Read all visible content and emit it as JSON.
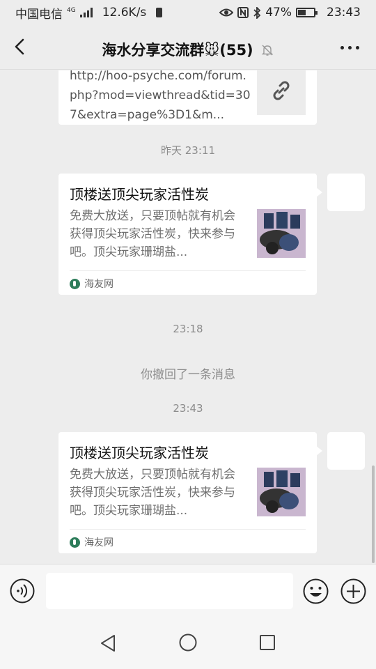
{
  "status": {
    "carrier": "中国电信",
    "network_sup": "4G",
    "speed": "12.6K/s",
    "battery": "47%",
    "battery_level": 0.47,
    "time": "23:43"
  },
  "header": {
    "title": "海水分享交流群🐭(55)",
    "back_icon": "chevron-left-icon",
    "mute_icon": "bell-off-icon",
    "more_icon": "more-dots-icon"
  },
  "messages": {
    "prev_link_text": "http://hoo-psyche.com/forum.php?mod=viewthread&tid=307&extra=page%3D1&m...",
    "time1": "昨天 23:11",
    "card1": {
      "title": "顶楼送顶尖玩家活性炭",
      "desc": "免费大放送，只要顶帖就有机会获得顶尖玩家活性炭，快来参与吧。顶尖玩家珊瑚盐...",
      "source": "海友网"
    },
    "time2": "23:18",
    "recall": "你撤回了一条消息",
    "time3": "23:43",
    "card2": {
      "title": "顶楼送顶尖玩家活性炭",
      "desc": "免费大放送，只要顶帖就有机会获得顶尖玩家活性炭，快来参与吧。顶尖玩家珊瑚盐...",
      "source": "海友网"
    }
  },
  "input": {
    "value": "",
    "voice_icon": "voice-icon",
    "emoji_icon": "emoji-icon",
    "plus_icon": "plus-circle-icon"
  },
  "colors": {
    "background": "#ededed",
    "card": "#ffffff",
    "meta_text": "#8c8c8c"
  }
}
